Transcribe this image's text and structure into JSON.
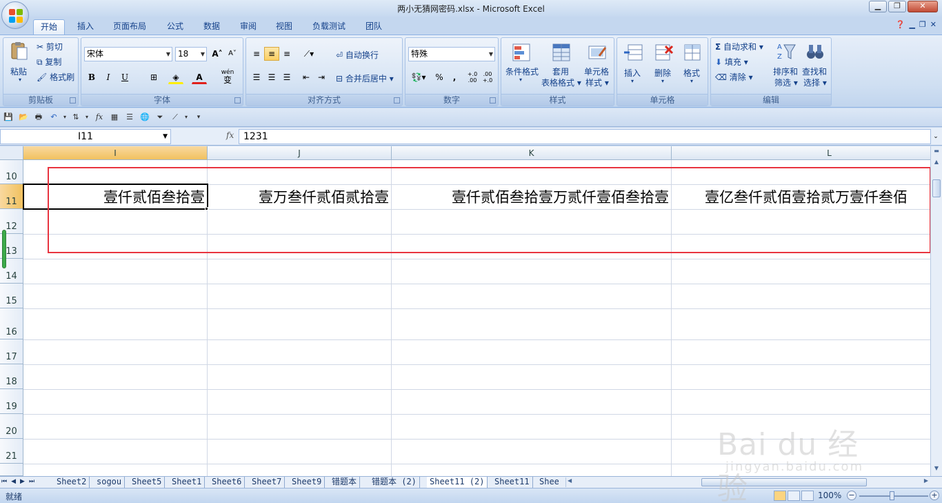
{
  "window": {
    "title": "两小无猜网密码.xlsx - Microsoft Excel"
  },
  "tabs": [
    "开始",
    "插入",
    "页面布局",
    "公式",
    "数据",
    "审阅",
    "视图",
    "负载测试",
    "团队"
  ],
  "active_tab": "开始",
  "ribbon": {
    "clipboard": {
      "label": "剪贴板",
      "paste": "粘贴",
      "cut": "剪切",
      "copy": "复制",
      "format_painter": "格式刷"
    },
    "font": {
      "label": "字体",
      "font_name": "宋体",
      "font_size": "18",
      "bold": "B",
      "italic": "I",
      "underline": "U",
      "grow": "A",
      "shrink": "A",
      "font_color": "A",
      "wen": "wén",
      "wen_char": "变"
    },
    "alignment": {
      "label": "对齐方式",
      "wrap_text": "自动换行",
      "merge_center": "合并后居中"
    },
    "number": {
      "label": "数字",
      "format": "特殊",
      "percent": "%",
      "comma": ",",
      "inc_dec": "+.0 .00",
      "dec_dec": ".00 +.0"
    },
    "styles": {
      "label": "样式",
      "conditional": "条件格式",
      "table_format_1": "套用",
      "table_format_2": "表格格式",
      "cell_styles_1": "单元格",
      "cell_styles_2": "样式"
    },
    "cells": {
      "label": "单元格",
      "insert": "插入",
      "delete": "删除",
      "format": "格式"
    },
    "editing": {
      "label": "编辑",
      "autosum": "自动求和",
      "fill": "填充",
      "clear": "清除",
      "sort_filter_1": "排序和",
      "sort_filter_2": "筛选",
      "find_select_1": "查找和",
      "find_select_2": "选择"
    }
  },
  "formula_bar": {
    "name_box": "I11",
    "fx": "fx",
    "formula": "1231"
  },
  "columns": [
    "I",
    "J",
    "K",
    "L"
  ],
  "rows": [
    "10",
    "11",
    "12",
    "13",
    "14",
    "15",
    "16",
    "17",
    "18",
    "19",
    "20",
    "21"
  ],
  "cells": {
    "I11": "壹仟贰佰叁拾壹",
    "J11": "壹万叁仟贰佰贰拾壹",
    "K11": "壹仟贰佰叁拾壹万贰仟壹佰叁拾壹",
    "L11": "壹亿叁仟贰佰壹拾贰万壹仟叁佰"
  },
  "sheet_tabs": [
    "Sheet2",
    "sogou",
    "Sheet5",
    "Sheet1",
    "Sheet6",
    "Sheet7",
    "Sheet9",
    "错题本",
    "错题本 (2)",
    "Sheet11 (2)",
    "Sheet11",
    "Shee"
  ],
  "active_sheet": "Sheet11 (2)",
  "status": {
    "ready": "就绪",
    "zoom": "100%",
    "minus": "−",
    "plus": "+"
  },
  "watermark": {
    "main": "Bai du 经验",
    "sub": "jingyan.baidu.com"
  },
  "colors": {
    "ribbon_bg": "#cfdff2",
    "annotation": "#e8343f",
    "selected_header": "#f1c15f"
  }
}
